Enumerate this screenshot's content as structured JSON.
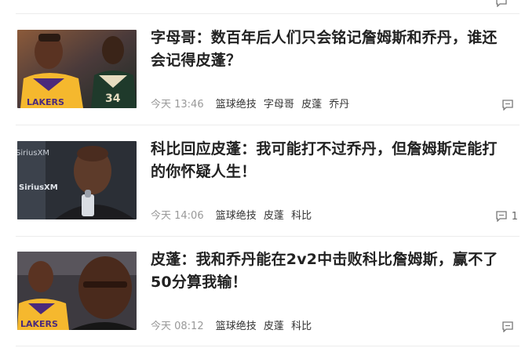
{
  "articles": [
    {
      "title": "字母哥：数百年后人们只会铭记詹姆斯和乔丹，谁还会记得皮蓬？",
      "time": "今天 13:46",
      "tags": [
        "篮球绝技",
        "字母哥",
        "皮蓬",
        "乔丹"
      ],
      "comments": "",
      "thumb_text": [
        "LAKERS",
        "34"
      ],
      "icon": "comment-icon"
    },
    {
      "title": "科比回应皮蓬：我可能打不过乔丹，但詹姆斯定能打的你怀疑人生！",
      "time": "今天 14:06",
      "tags": [
        "篮球绝技",
        "皮蓬",
        "科比"
      ],
      "comments": "1",
      "thumb_text": [
        "SiriusXM",
        "SiriusXM"
      ],
      "icon": "comment-icon"
    },
    {
      "title": "皮蓬：我和乔丹能在2v2中击败科比詹姆斯，赢不了50分算我输！",
      "time": "今天 08:12",
      "tags": [
        "篮球绝技",
        "皮蓬",
        "科比"
      ],
      "comments": "",
      "thumb_text": [
        "LAKERS"
      ],
      "icon": "comment-icon"
    }
  ],
  "colors": {
    "title": "#222222",
    "time": "#999999",
    "tag": "#333333",
    "separator": "#ececec",
    "lakers_gold": "#f5b82e",
    "lakers_purple": "#4b2a7b",
    "bucks_green": "#1f3a2b"
  }
}
